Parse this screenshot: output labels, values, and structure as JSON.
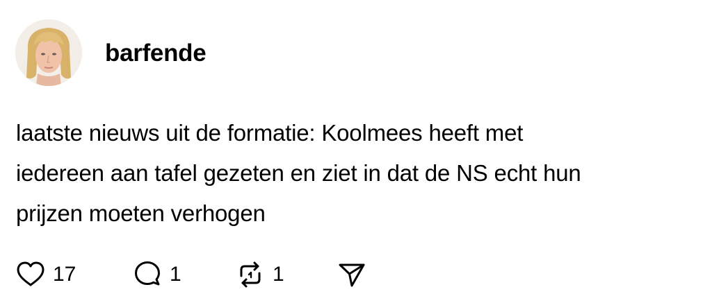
{
  "post": {
    "username": "barfende",
    "text": "laatste nieuws uit de formatie: Koolmees heeft met\niedereen aan tafel gezeten en ziet in dat de NS echt hun\nprijzen moeten verhogen",
    "avatar_icon": "profile-photo"
  },
  "actions": {
    "likes": {
      "icon": "heart-icon",
      "count": "17"
    },
    "replies": {
      "icon": "comment-bubble-icon",
      "count": "1"
    },
    "reposts": {
      "icon": "repost-icon",
      "count": "1"
    },
    "share": {
      "icon": "send-icon"
    }
  }
}
